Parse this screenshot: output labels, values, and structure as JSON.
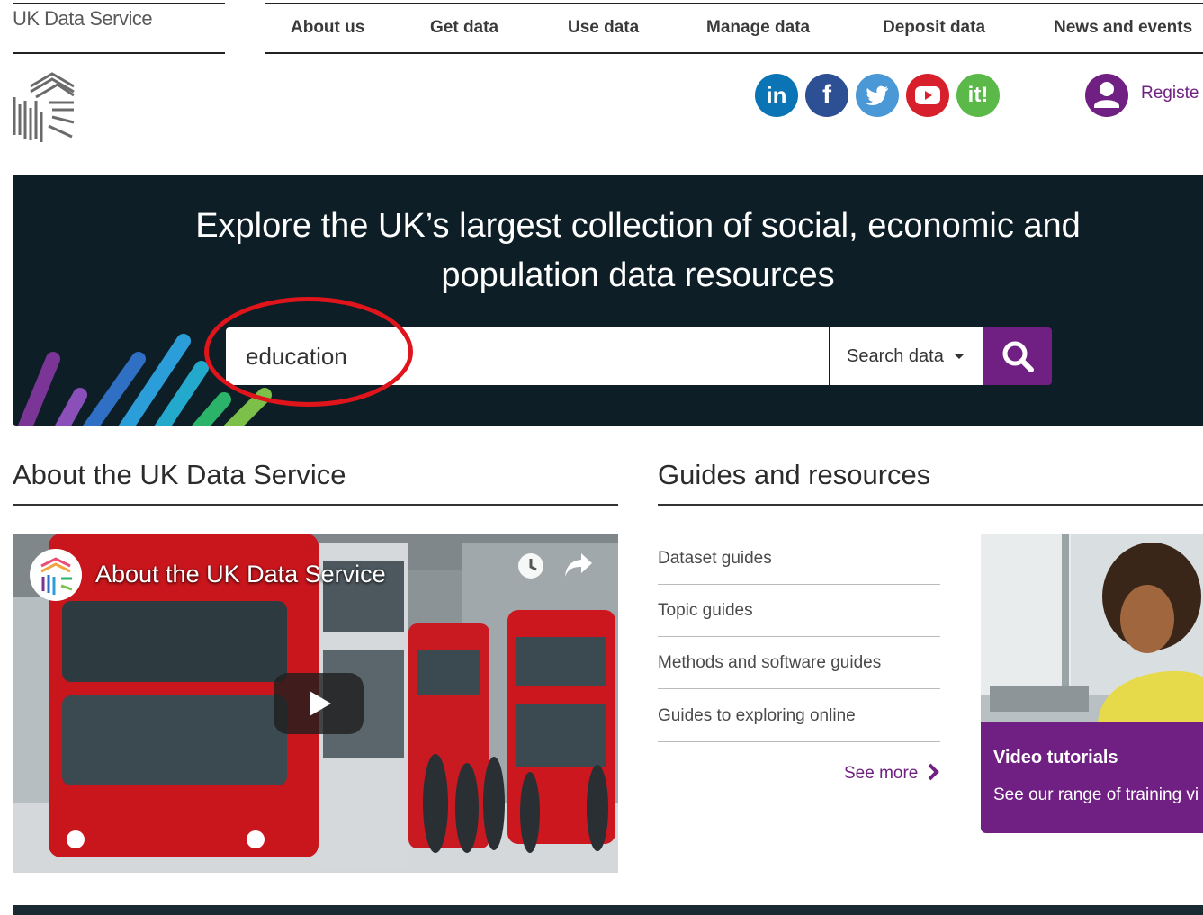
{
  "header": {
    "logo_text": "UK Data Service",
    "nav": [
      {
        "label": "About us"
      },
      {
        "label": "Get data"
      },
      {
        "label": "Use data"
      },
      {
        "label": "Manage data"
      },
      {
        "label": "Deposit data"
      },
      {
        "label": "News and events"
      }
    ],
    "social": [
      {
        "name": "linkedin-icon",
        "glyph": "in",
        "color": "#0a74b5"
      },
      {
        "name": "facebook-icon",
        "glyph": "f",
        "color": "#2d4f93"
      },
      {
        "name": "twitter-icon",
        "glyph": "",
        "color": "#4a98d6"
      },
      {
        "name": "youtube-icon",
        "glyph": "",
        "color": "#d8202c"
      },
      {
        "name": "ithenticate-icon",
        "glyph": "it!",
        "color": "#5bb94a"
      }
    ],
    "register_label": "Registe"
  },
  "hero": {
    "title_line1": "Explore the UK’s largest collection of social, economic and",
    "title_line2": "population data resources",
    "search_value": "education",
    "search_select": "Search data",
    "accent_color": "#702082"
  },
  "about": {
    "title": "About the UK Data Service",
    "video_title": "About the UK Data Service"
  },
  "guides": {
    "title": "Guides and resources",
    "items": [
      {
        "label": "Dataset guides"
      },
      {
        "label": "Topic guides"
      },
      {
        "label": "Methods and software guides"
      },
      {
        "label": "Guides to exploring online"
      }
    ],
    "see_more": "See more",
    "card": {
      "title": "Video tutorials",
      "desc": "See our range of training vi"
    }
  }
}
